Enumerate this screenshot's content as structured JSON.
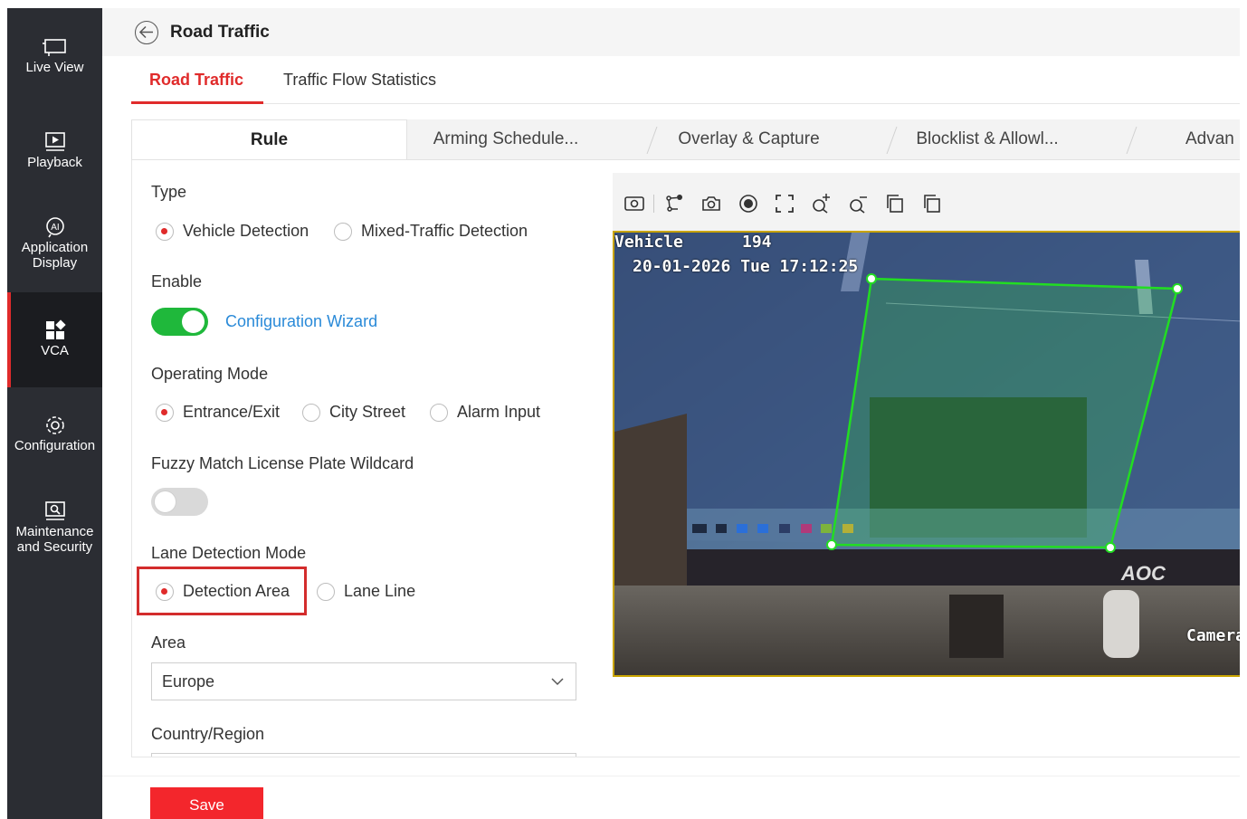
{
  "sidebar": {
    "items": [
      {
        "label": "Live View",
        "icon": "monitor-icon"
      },
      {
        "label": "Playback",
        "icon": "play-icon"
      },
      {
        "label": "Application Display",
        "icon": "ai-icon"
      },
      {
        "label": "VCA",
        "icon": "grid-icon",
        "active": true
      },
      {
        "label": "Configuration",
        "icon": "gear-icon"
      },
      {
        "label": "Maintenance and Security",
        "icon": "wrench-icon"
      }
    ],
    "active_color": "#e02b2b"
  },
  "header": {
    "title": "Road Traffic",
    "back_icon": "back-arrow-icon"
  },
  "top_tabs": [
    {
      "label": "Road Traffic",
      "active": true
    },
    {
      "label": "Traffic Flow Statistics",
      "active": false
    }
  ],
  "sub_tabs": [
    {
      "label": "Rule",
      "active": true
    },
    {
      "label": "Arming Schedule...",
      "active": false
    },
    {
      "label": "Overlay & Capture",
      "active": false
    },
    {
      "label": "Blocklist & Allowl...",
      "active": false
    },
    {
      "label": "Advan",
      "active": false
    }
  ],
  "form": {
    "type": {
      "label": "Type",
      "options": [
        "Vehicle Detection",
        "Mixed-Traffic Detection"
      ],
      "selected": "Vehicle Detection"
    },
    "enable": {
      "label": "Enable",
      "on": true,
      "wizard_link": "Configuration Wizard"
    },
    "operating_mode": {
      "label": "Operating Mode",
      "options": [
        "Entrance/Exit",
        "City Street",
        "Alarm Input"
      ],
      "selected": "Entrance/Exit"
    },
    "fuzzy_match": {
      "label": "Fuzzy Match License Plate Wildcard",
      "on": false
    },
    "lane_detection_mode": {
      "label": "Lane Detection Mode",
      "options": [
        "Detection Area",
        "Lane Line"
      ],
      "selected": "Detection Area"
    },
    "area": {
      "label": "Area",
      "value": "Europe"
    },
    "country_region": {
      "label": "Country/Region"
    }
  },
  "video": {
    "toolbar_icons": [
      "snapshot-frame-icon",
      "draw-polygon-icon",
      "camera-icon",
      "record-icon",
      "fullscreen-icon",
      "zoom-in-icon",
      "zoom-out-icon",
      "copy-icon",
      "paste-icon"
    ],
    "osd_line1_label": "Vehicle",
    "osd_line1_value": "194",
    "osd_line2": "20-01-2026 Tue 17:12:25",
    "osd_brand": "AOC",
    "osd_camera": "Camera"
  },
  "footer": {
    "save_label": "Save"
  },
  "colors": {
    "accent": "#e02b2b",
    "switch_on": "#1fb83b",
    "link": "#2a8ad8",
    "detection_area": "#22dd22"
  }
}
